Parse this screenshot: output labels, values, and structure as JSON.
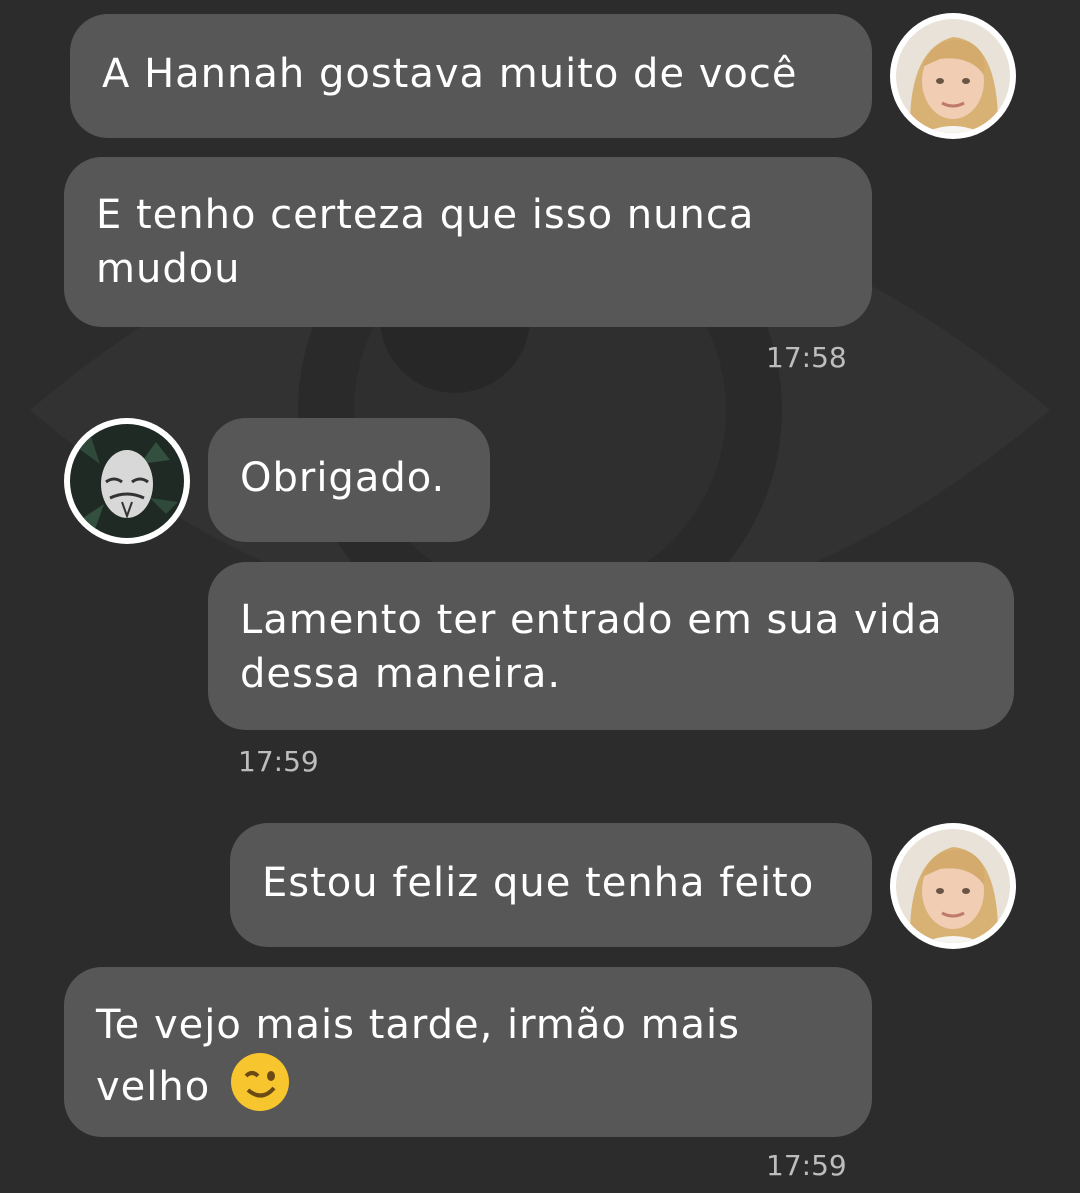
{
  "messages": [
    {
      "text": "A Hannah gostava muito de você"
    },
    {
      "text": "E tenho certeza que isso nunca mudou"
    },
    {
      "text": "Obrigado."
    },
    {
      "text": "Lamento ter entrado em sua vida dessa maneira."
    },
    {
      "text": "Estou feliz que tenha feito"
    },
    {
      "text": "Te vejo mais tarde, irmão mais velho"
    }
  ],
  "timestamps": [
    "17:58",
    "17:59",
    "17:59"
  ],
  "emoji": {
    "wink": "winking-face"
  },
  "colors": {
    "background": "#2c2c2c",
    "bubble": "#575757",
    "text": "#ffffff",
    "timestamp": "#bdbdbd"
  }
}
